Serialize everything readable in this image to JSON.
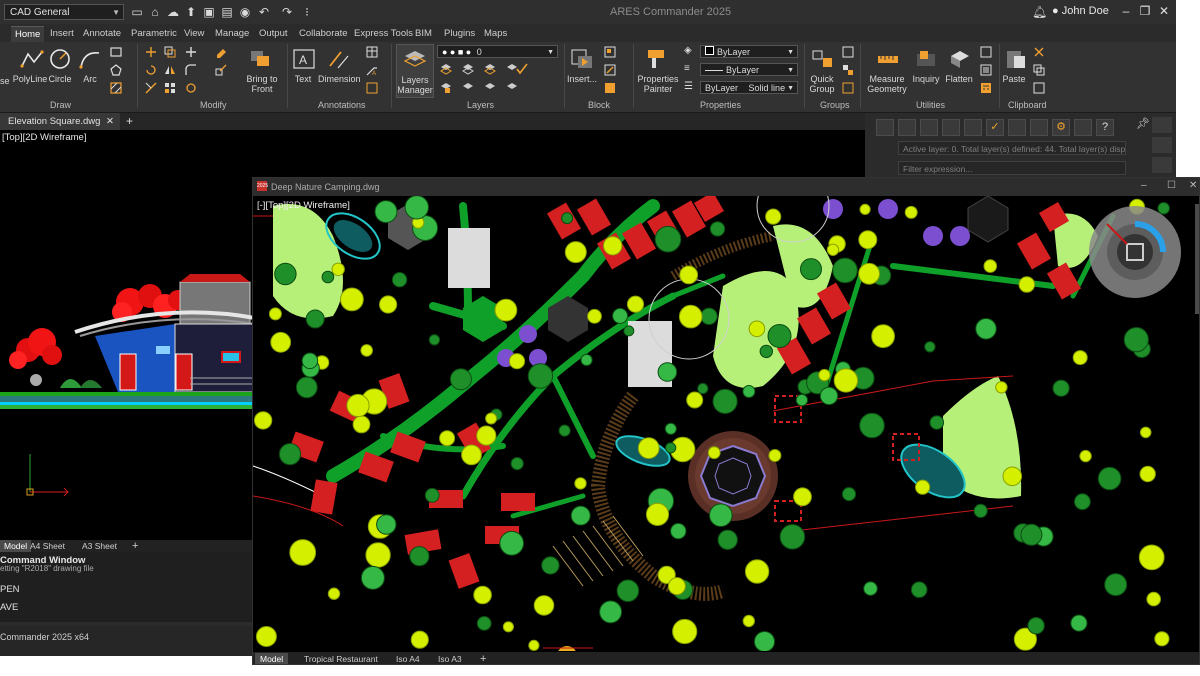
{
  "app": {
    "title": "ARES Commander 2025",
    "workspace": "CAD General",
    "user": "John Doe"
  },
  "ribbon_tabs": [
    "Home",
    "Insert",
    "Annotate",
    "Parametric",
    "View",
    "Manage",
    "Output",
    "Collaborate",
    "Express Tools",
    "BIM",
    "Plugins",
    "Maps"
  ],
  "ribbon": {
    "draw": {
      "label": "Draw",
      "polyline": "PolyLine",
      "circle": "Circle",
      "arc": "Arc",
      "partial": "se"
    },
    "modify": {
      "label": "Modify",
      "bring_to_front": "Bring to Front"
    },
    "annotations": {
      "label": "Annotations",
      "text": "Text",
      "dimension": "Dimension"
    },
    "layers": {
      "label": "Layers",
      "manager": "Layers Manager",
      "current_layer": "0"
    },
    "block": {
      "label": "Block",
      "insert": "Insert..."
    },
    "properties": {
      "label": "Properties",
      "painter": "Properties Painter",
      "color": "ByLayer",
      "linetype": "ByLayer",
      "lineweight": "ByLayer",
      "linestyle": "Solid line"
    },
    "groups": {
      "label": "Groups",
      "quick_group": "Quick Group"
    },
    "utilities": {
      "label": "Utilities",
      "measure": "Measure Geometry",
      "inquiry": "Inquiry",
      "flatten": "Flatten"
    },
    "clipboard": {
      "label": "Clipboard",
      "paste": "Paste"
    }
  },
  "doc1": {
    "tab": "Elevation Square.dwg",
    "viewport": "[Top][2D Wireframe]",
    "layout_tabs": [
      "Model",
      "A4 Sheet",
      "A3 Sheet"
    ]
  },
  "layer_panel": {
    "info": "Active layer: 0. Total layer(s) defined: 44. Total layer(s) displayed",
    "filter_placeholder": "Filter expression..."
  },
  "command": {
    "title": "Command Window",
    "lines": [
      "etting \"R2018\" drawing file",
      "PEN",
      "AVE"
    ],
    "status": "Commander 2025 x64"
  },
  "doc2": {
    "name": "Deep Nature Camping.dwg",
    "badge": "2025",
    "viewport": "[-][Top][2D Wireframe]",
    "layout_tabs": [
      "Model",
      "Tropical Restaurant",
      "Iso A4",
      "Iso A3"
    ]
  },
  "colors": {
    "accent": "#f0a030",
    "tree_yellow": "#d4f000",
    "path_green": "#0fa02a",
    "cabin_red": "#d42020",
    "lawn": "#b7f079",
    "water": "#22c4c8",
    "violet": "#7b4fd0"
  }
}
